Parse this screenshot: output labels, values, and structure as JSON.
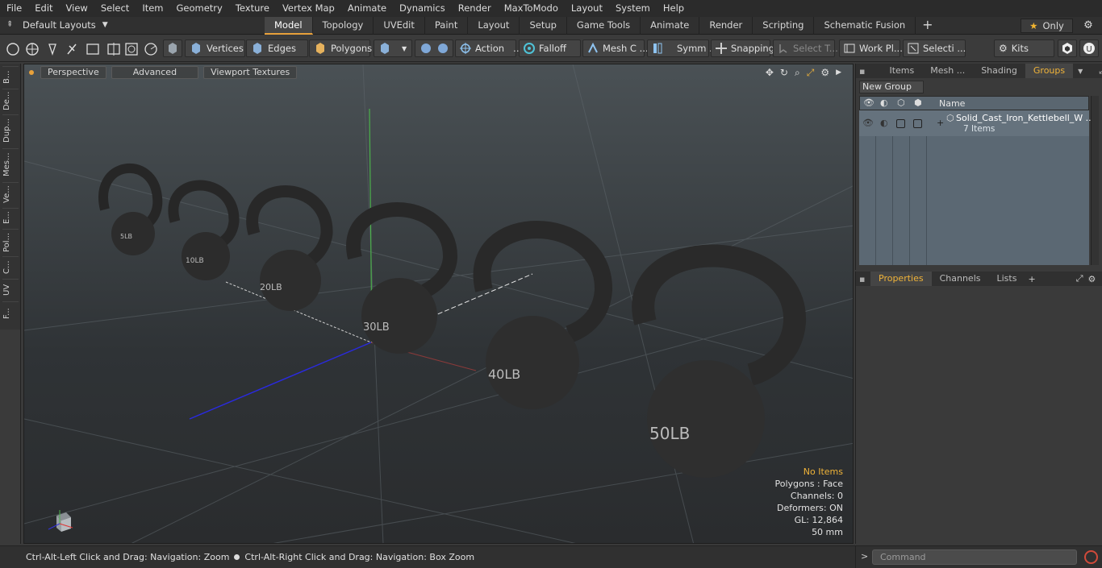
{
  "menu": [
    "File",
    "Edit",
    "View",
    "Select",
    "Item",
    "Geometry",
    "Texture",
    "Vertex Map",
    "Animate",
    "Dynamics",
    "Render",
    "MaxToModo",
    "Layout",
    "System",
    "Help"
  ],
  "layouts_label": "Default Layouts",
  "tabs": [
    "Model",
    "Topology",
    "UVEdit",
    "Paint",
    "Layout",
    "Setup",
    "Game Tools",
    "Animate",
    "Render",
    "Scripting",
    "Schematic Fusion"
  ],
  "only_label": "Only",
  "toolbar": {
    "vertices": "Vertices",
    "edges": "Edges",
    "polygons": "Polygons",
    "action": "Action",
    "falloff": "Falloff",
    "mesh": "Mesh C ...",
    "symmetry": "Symm ...",
    "snapping": "Snapping",
    "select_t": "Select T...",
    "workplane": "Work Pl...",
    "selection": "Selecti ...",
    "kits": "Kits"
  },
  "left_tabs": [
    "B...",
    "De...",
    "Dup...",
    "Mes...",
    "Ve...",
    "E...",
    "Pol...",
    "C...",
    "UV",
    "F..."
  ],
  "viewport": {
    "tabs": [
      "Perspective",
      "Advanced",
      "Viewport Textures"
    ],
    "info": {
      "no_items": "No Items",
      "polygons": "Polygons : Face",
      "channels": "Channels: 0",
      "deformers": "Deformers: ON",
      "gl": "GL: 12,864",
      "focal": "50 mm"
    },
    "weights": [
      "5LB",
      "10LB",
      "20LB",
      "30LB",
      "40LB",
      "50LB"
    ]
  },
  "status": {
    "left": "Ctrl-Alt-Left Click and Drag: Navigation: Zoom",
    "right": "Ctrl-Alt-Right Click and Drag: Navigation: Box Zoom"
  },
  "right_panel": {
    "tabs": [
      "Items",
      "Mesh ...",
      "Shading",
      "Groups"
    ],
    "new_group": "New Group",
    "name_header": "Name",
    "group_name": "Solid_Cast_Iron_Kettlebell_W ...",
    "group_count": "7 Items"
  },
  "props": {
    "tabs": [
      "Properties",
      "Channels",
      "Lists"
    ]
  },
  "command_placeholder": "Command",
  "colors": {
    "accent": "#e8a13a",
    "highlight": "#f0b339"
  }
}
